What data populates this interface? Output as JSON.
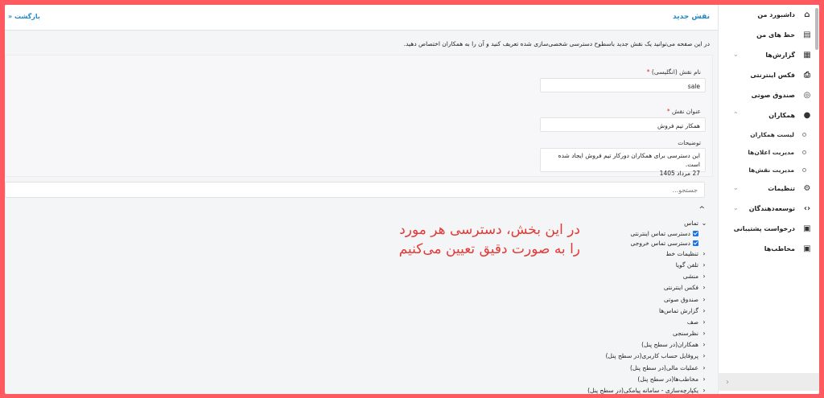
{
  "header": {
    "title": "نقش جدید",
    "back_label": "بازگشت",
    "back_arrow": "«"
  },
  "description": "در این صفحه می‌توانید یک نقش جدید باسطوح دسترسی شخصی‌سازی شده تعریف کنید و آن را به همکاران اختصاص دهید.",
  "form": {
    "role_name_label": "نام نقش (انگلیسی)",
    "role_name_value": "sale",
    "role_title_label": "عنوان نقش",
    "role_title_value": "همکار تیم فروش",
    "required_mark": "*",
    "description_label": "توضیحات",
    "description_line1": "این دسترسی برای همکاران دورکار تیم فروش ایجاد شده است.",
    "description_line2": "27 مرداد 1405"
  },
  "search": {
    "placeholder": "جستجو..."
  },
  "tree": {
    "toggle": "^",
    "expanded": {
      "label": "تماس",
      "children": [
        "دسترسی تماس اینترنتی",
        "دسترسی تماس خروجی"
      ]
    },
    "collapsed": [
      "تنظیمات خط",
      "تلفن گویا",
      "منشی",
      "فکس اینترنتی",
      "صندوق صوتی",
      "گزارش تماس‌ها",
      "صف",
      "نظرسنجی",
      "همکاران(در سطح پنل)",
      "پروفایل حساب کاربری(در سطح پنل)",
      "عملیات مالی(در سطح پنل)",
      "مخاطب‌ها(در سطح پنل)",
      "یکپارچه‌سازی - سامانه پیامکی(در سطح پنل)"
    ]
  },
  "annotation": {
    "line1": "در این بخش، دسترسی هر مورد",
    "line2": "را به صورت دقیق تعیین می‌کنیم"
  },
  "sidebar": {
    "items": [
      {
        "label": "داشبورد من",
        "icon": "home-icon"
      },
      {
        "label": "خط های من",
        "icon": "book-icon"
      },
      {
        "label": "گزارش‌ها",
        "icon": "document-icon"
      },
      {
        "label": "فکس اینترنتی",
        "icon": "fax-icon"
      },
      {
        "label": "صندوق صوتی",
        "icon": "voicemail-icon"
      },
      {
        "label": "همکاران",
        "icon": "users-icon"
      }
    ],
    "sub_items": [
      "لیست همکاران",
      "مدیریت اعلان‌ها",
      "مدیریت نقش‌ها"
    ],
    "items_after": [
      {
        "label": "تنظیمات",
        "icon": "gear-icon"
      },
      {
        "label": "توسعه‌دهندگان",
        "icon": "code-icon"
      },
      {
        "label": "درخواست پشتیبانی",
        "icon": "ticket-icon"
      },
      {
        "label": "مخاطب‌ها",
        "icon": "contact-icon"
      }
    ],
    "collapse_arrow": "›"
  },
  "colors": {
    "accent": "#1e88c8",
    "annotation": "#e53935",
    "border_frame": "#ff5a5f"
  }
}
